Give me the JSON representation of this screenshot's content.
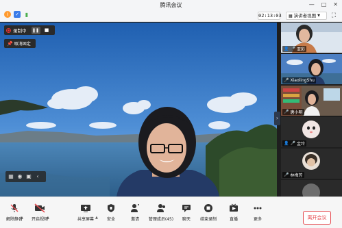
{
  "window": {
    "title": "腾讯会议",
    "controls": [
      "—",
      "□",
      "✕"
    ]
  },
  "header": {
    "timer": "02:13:03",
    "view_mode": "演讲者视图",
    "status_icons": [
      "info-icon",
      "security-shield-icon",
      "signal-icon"
    ]
  },
  "recording": {
    "label": "录制中",
    "pause_icon": "pause-icon",
    "stop_icon": "stop-icon"
  },
  "pin": {
    "label": "取消固定"
  },
  "participants": [
    {
      "name": "亚彩",
      "host": true,
      "muted": false
    },
    {
      "name": "XiaolingShu",
      "host": false,
      "muted": false
    },
    {
      "name": "唐小明",
      "host": false,
      "muted": false
    },
    {
      "name": "金玲",
      "host": true,
      "muted": false
    },
    {
      "name": "林梅芳",
      "host": false,
      "muted": false
    },
    {
      "name": "",
      "host": false,
      "muted": false
    }
  ],
  "toolbar": {
    "items": [
      {
        "label": "解除静音",
        "icon": "mic-muted-icon",
        "caret": true
      },
      {
        "label": "开启视频",
        "icon": "camera-off-icon",
        "caret": true
      },
      {
        "label": "共享屏幕",
        "icon": "share-screen-icon",
        "caret": true
      },
      {
        "label": "安全",
        "icon": "security-icon",
        "caret": false
      },
      {
        "label": "邀请",
        "icon": "invite-icon",
        "caret": false
      },
      {
        "label": "管理成员(45)",
        "icon": "members-icon",
        "caret": false
      },
      {
        "label": "聊天",
        "icon": "chat-icon",
        "caret": false
      },
      {
        "label": "结束录制",
        "icon": "stop-record-icon",
        "caret": false
      },
      {
        "label": "直播",
        "icon": "live-icon",
        "caret": false
      },
      {
        "label": "更多",
        "icon": "more-icon",
        "caret": false
      }
    ],
    "leave_label": "离开会议"
  },
  "colors": {
    "accent": "#e5484d",
    "mic_on": "#4caf50",
    "host": "#ff9a2e",
    "toolbar_bg": "#f6f6f6"
  }
}
